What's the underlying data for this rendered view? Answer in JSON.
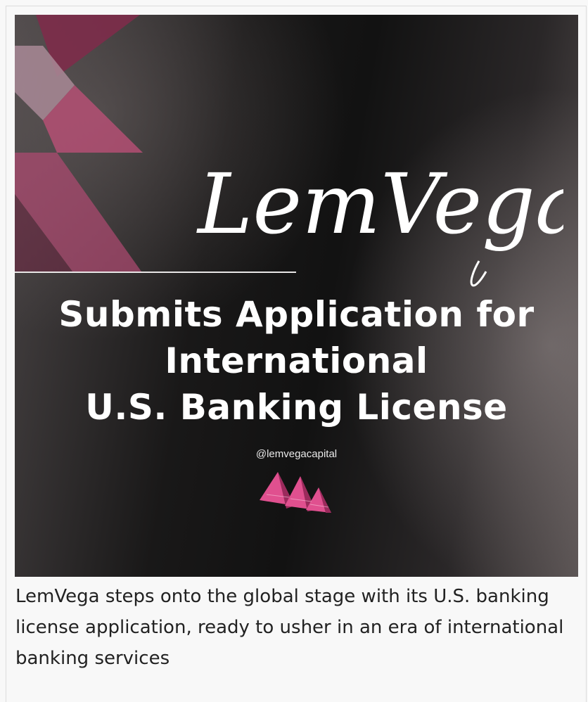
{
  "figure": {
    "brand_script": "LemVega",
    "headline": {
      "line1": "Submits Application for",
      "line2": "International",
      "line3": "U.S. Banking License"
    },
    "handle": "@lemvegacapital",
    "logo_icon": "pink-triangles-logo-icon",
    "colors": {
      "accent_pink": "#c2507a",
      "dark_bg": "#141414",
      "text_white": "#ffffff"
    }
  },
  "caption": "LemVega steps onto the global stage with its U.S. banking license application, ready to usher in an era of international banking services"
}
